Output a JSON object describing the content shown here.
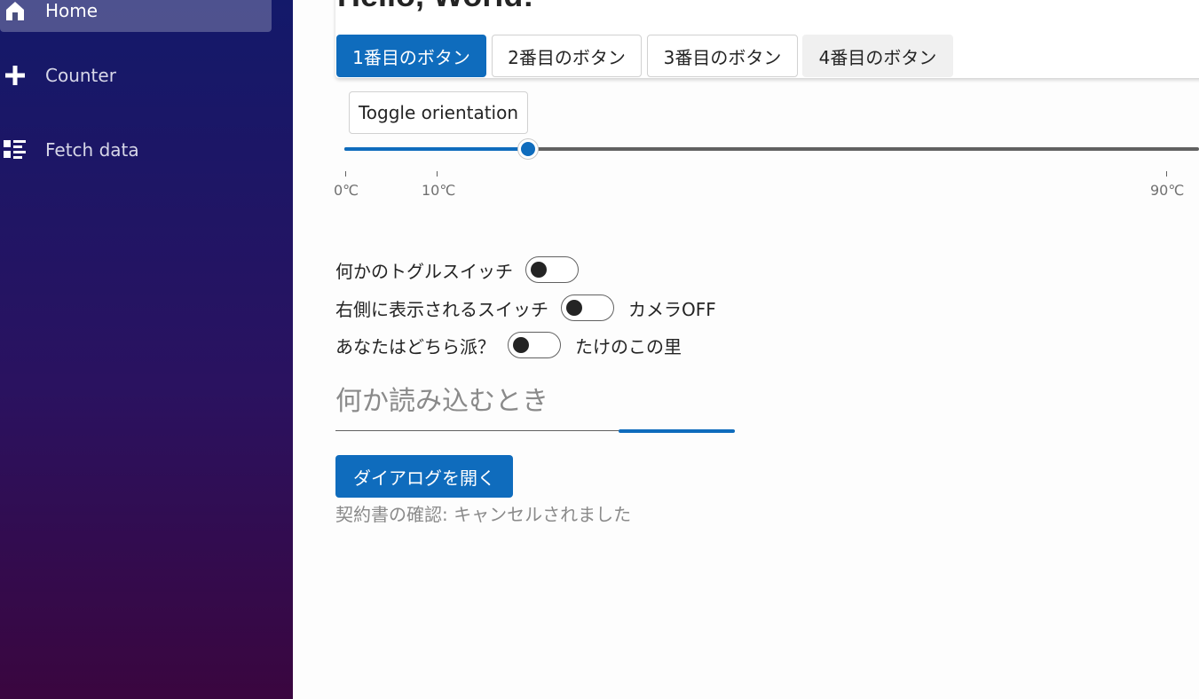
{
  "sidebar": {
    "items": [
      {
        "label": "Home",
        "icon": "home-icon",
        "active": true
      },
      {
        "label": "Counter",
        "icon": "plus-icon",
        "active": false
      },
      {
        "label": "Fetch data",
        "icon": "list-icon",
        "active": false
      }
    ]
  },
  "header": {
    "title": "Hello, World!",
    "buttons": [
      {
        "label": "1番目のボタン",
        "style": "primary"
      },
      {
        "label": "2番目のボタン",
        "style": "outline"
      },
      {
        "label": "3番目のボタン",
        "style": "outline"
      },
      {
        "label": "4番目のボタン",
        "style": "subtle"
      }
    ]
  },
  "slider": {
    "toggle_label": "Toggle orientation",
    "value": 20,
    "min": 0,
    "max": 90,
    "unit": "℃",
    "tick_labels": [
      "0℃",
      "10℃",
      "90℃"
    ]
  },
  "switches": [
    {
      "label": "何かのトグルスイッチ",
      "checked": false,
      "after_label": ""
    },
    {
      "label": "右側に表示されるスイッチ",
      "checked": false,
      "after_label": "カメラOFF"
    },
    {
      "label": "あなたはどちら派？",
      "checked": false,
      "after_label": "たけのこの里"
    }
  ],
  "loading": {
    "label": "何か読み込むとき"
  },
  "dialog": {
    "button_label": "ダイアログを開く",
    "status": "契約書の確認: キャンセルされました"
  },
  "colors": {
    "accent": "#0f6cbd",
    "sidebar_top": "#13196a",
    "sidebar_bottom": "#3a063f"
  }
}
